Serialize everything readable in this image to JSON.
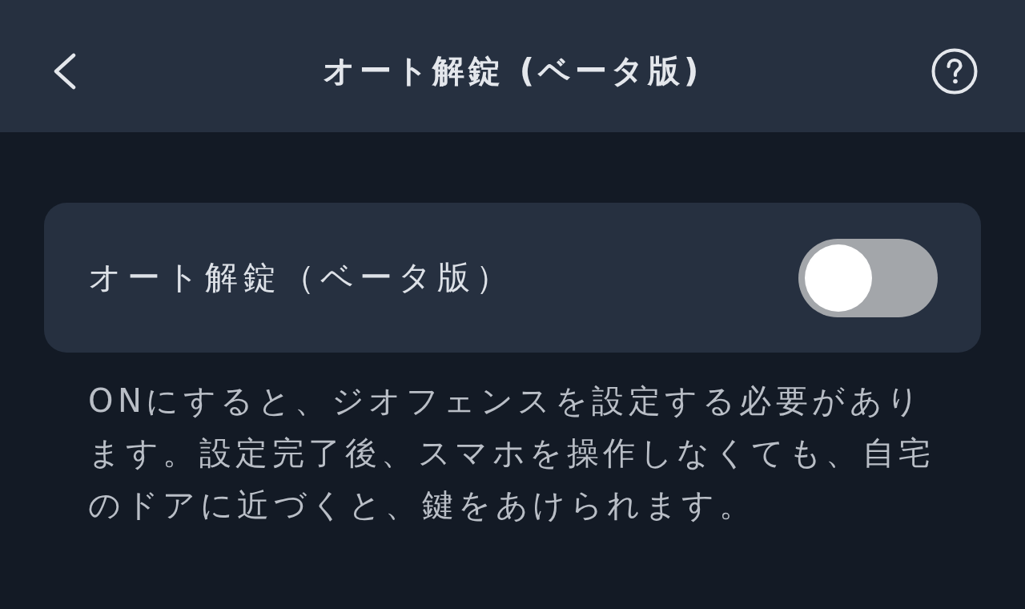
{
  "header": {
    "title": "オート解錠 (ベータ版)"
  },
  "setting": {
    "label": "オート解錠（ベータ版）",
    "on": false
  },
  "description": "ONにすると、ジオフェンスを設定する必要があります。設定完了後、スマホを操作しなくても、自宅のドアに近づくと、鍵をあけられます。"
}
